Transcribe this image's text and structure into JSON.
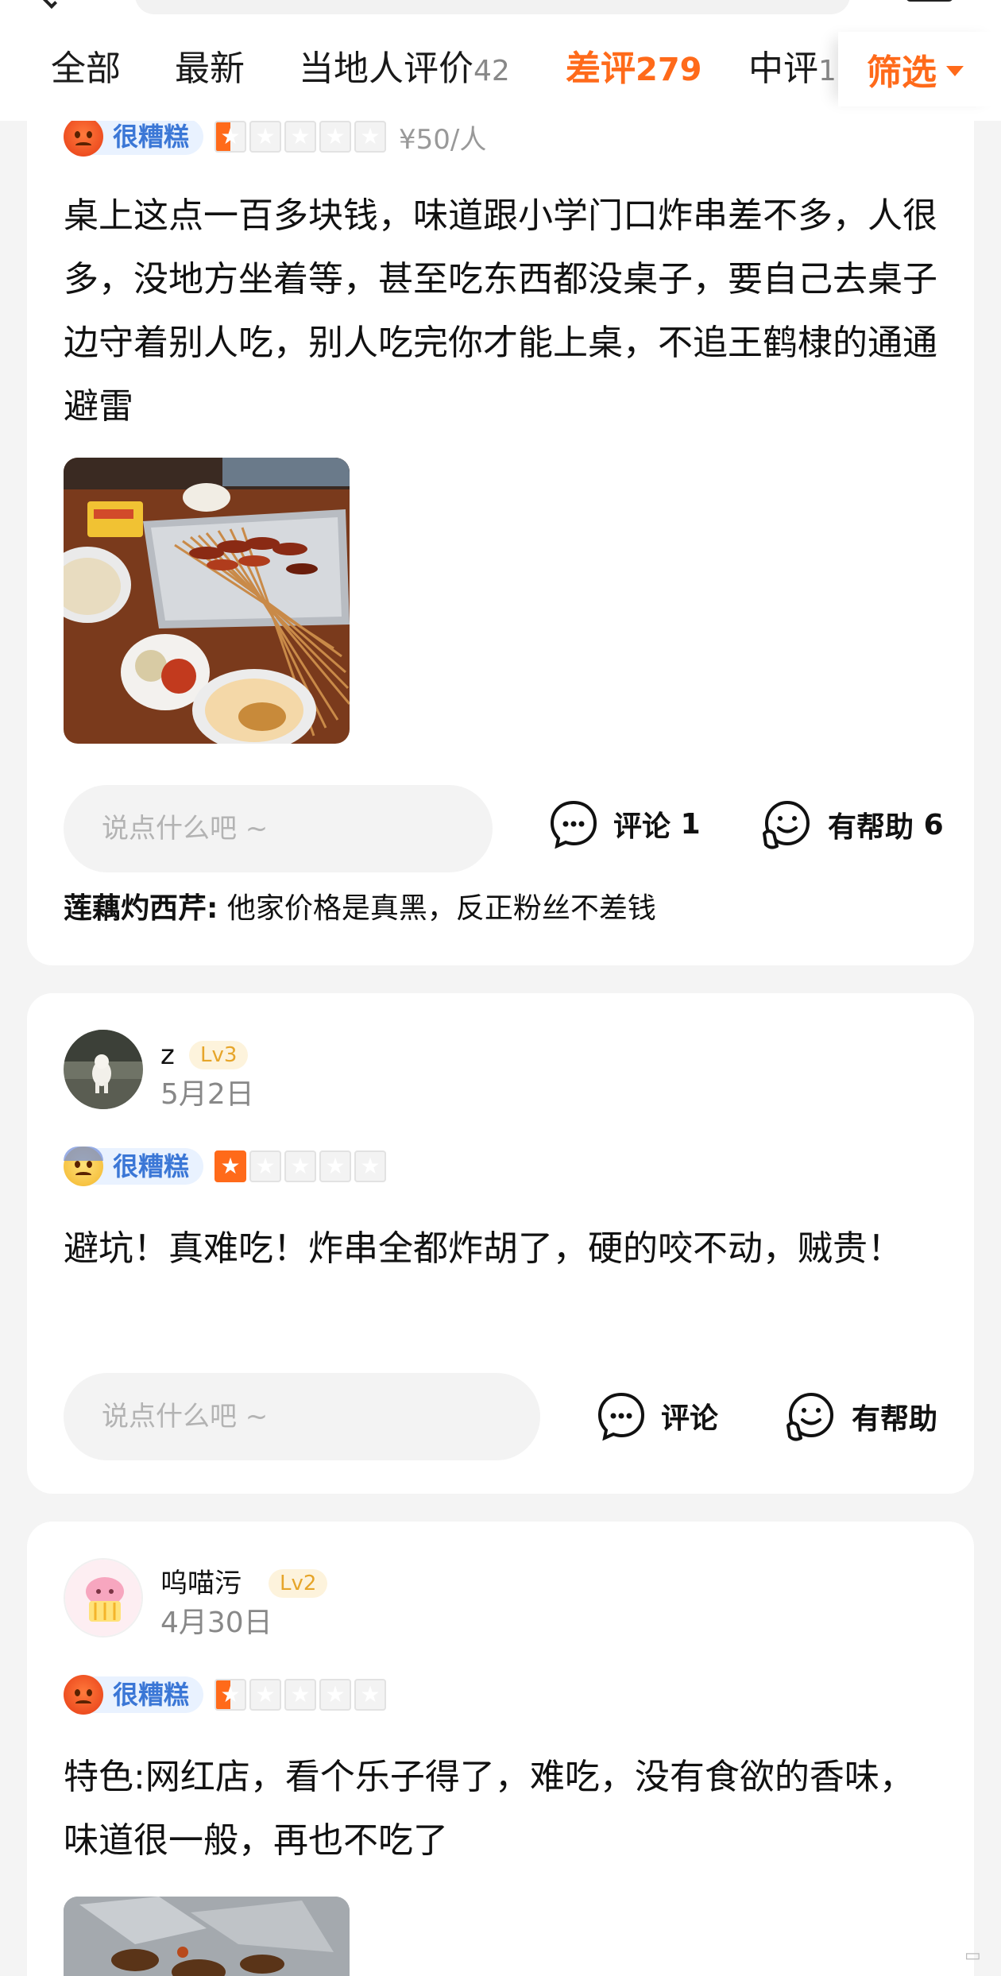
{
  "tabs": [
    {
      "label": "全部",
      "count": ""
    },
    {
      "label": "最新",
      "count": ""
    },
    {
      "label": "当地人评价",
      "count": "42"
    },
    {
      "label": "差评",
      "count": "279"
    },
    {
      "label": "中评",
      "count": "1"
    }
  ],
  "filter": {
    "label": "筛选",
    "icon": "caret-down-icon"
  },
  "colors": {
    "accent": "#ff6a1a",
    "badge_text": "#3b77d6",
    "badge_bg": "#e9f2ff",
    "level": "#e6a52a"
  },
  "reviews": [
    {
      "rating_label": "很糟糕",
      "rating_stars": 0.5,
      "price": "¥50/人",
      "text": "桌上这点一百多块钱，味道跟小学门口炸串差不多，人很多，没地方坐着等，甚至吃东西都没桌子，要自己去桌子边守着别人吃，别人吃完你才能上桌，不追王鹤棣的通通避雷",
      "comment_placeholder": "说点什么吧 ~",
      "comment_label": "评论",
      "comment_count": "1",
      "helpful_label": "有帮助",
      "helpful_count": "6",
      "reply": {
        "author": "莲藕灼西芹:",
        "text": " 他家价格是真黑，反正粉丝不差钱"
      }
    },
    {
      "username": "z",
      "level": "Lv3",
      "date": "5月2日",
      "rating_label": "很糟糕",
      "rating_stars": 1,
      "text": "避坑！真难吃！炸串全都炸胡了，硬的咬不动，贼贵！",
      "comment_placeholder": "说点什么吧 ~",
      "comment_label": "评论",
      "helpful_label": "有帮助"
    },
    {
      "username": "呜喵污",
      "level": "Lv2",
      "date": "4月30日",
      "rating_label": "很糟糕",
      "rating_stars": 0.5,
      "text": "特色:网红店，看个乐子得了，难吃，没有食欲的香味，味道很一般，再也不吃了"
    }
  ]
}
